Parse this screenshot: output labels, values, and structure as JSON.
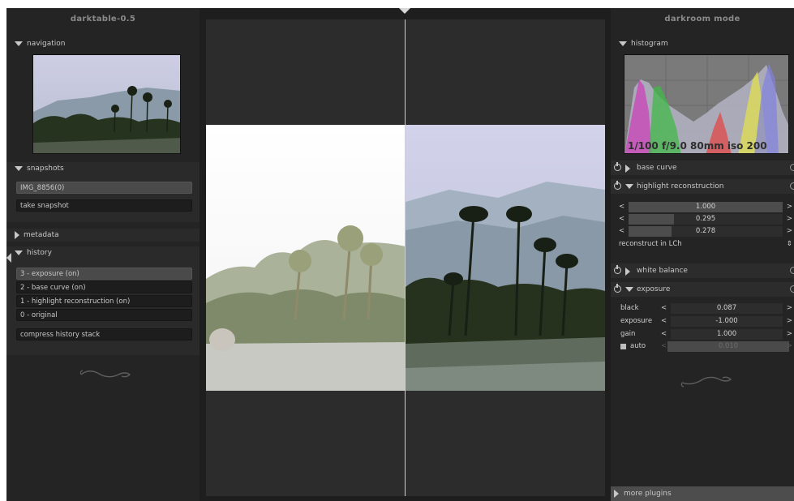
{
  "left_panel": {
    "title": "darktable-0.5",
    "navigation_label": "navigation",
    "snapshots_label": "snapshots",
    "snapshot_item": "IMG_8856(0)",
    "take_snapshot": "take snapshot",
    "metadata_label": "metadata",
    "history_label": "history",
    "history_items": [
      "3 - exposure (on)",
      "2 - base curve (on)",
      "1 - highlight reconstruction (on)",
      "0 - original"
    ],
    "compress_history": "compress history stack"
  },
  "right_panel": {
    "title": "darkroom mode",
    "histogram_label": "histogram",
    "histogram_info": "1/100 f/9.0 80mm iso 200",
    "base_curve_label": "base curve",
    "highlight_label": "highlight reconstruction",
    "highlight_sliders": [
      {
        "value": "1.000",
        "fraction": 1.0
      },
      {
        "value": "0.295",
        "fraction": 0.295
      },
      {
        "value": "0.278",
        "fraction": 0.278
      }
    ],
    "highlight_mode": "reconstruct in LCh",
    "white_balance_label": "white balance",
    "exposure_label": "exposure",
    "exposure_rows": [
      {
        "name": "black",
        "value": "0.087"
      },
      {
        "name": "exposure",
        "value": "-1.000"
      },
      {
        "name": "gain",
        "value": "1.000"
      }
    ],
    "auto_label": "auto",
    "auto_value": "0.010",
    "more_plugins": "more plugins"
  },
  "icons": {
    "expand": "triangle-down-icon",
    "collapse": "triangle-right-icon",
    "power": "power-icon",
    "reset": "reset-icon"
  },
  "colors": {
    "panel_bg": "#242424",
    "active_row": "#4a4a4a",
    "accent_text": "#c8c8c8"
  }
}
